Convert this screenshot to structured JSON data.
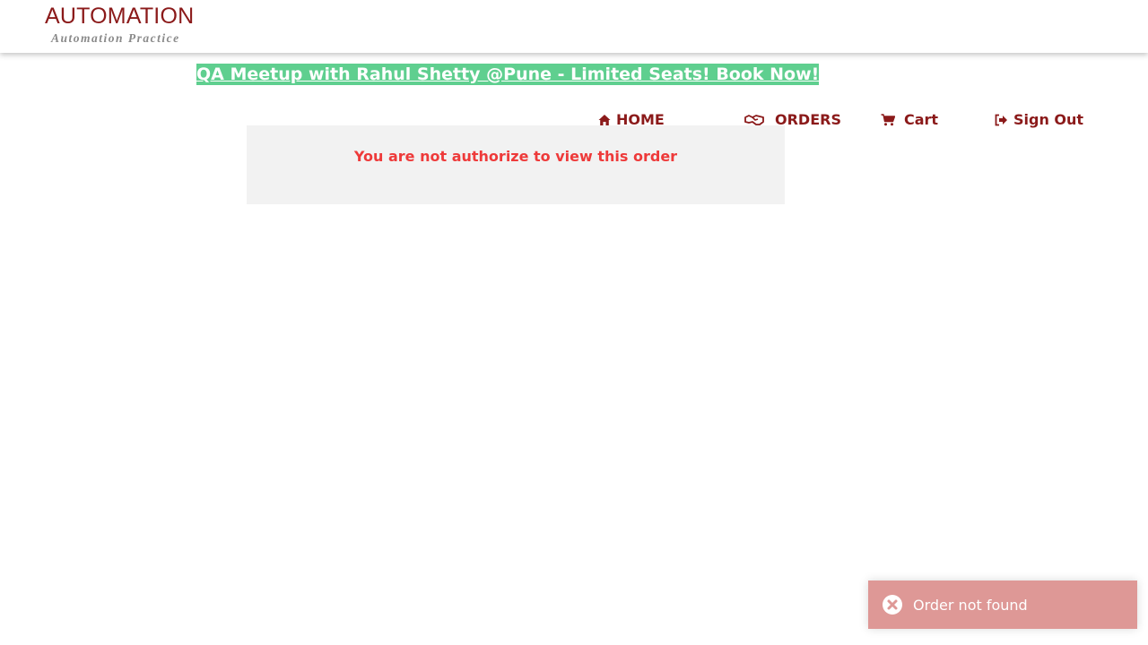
{
  "header": {
    "logo_title": "AUTOMATION",
    "logo_subtitle": "Automation Practice"
  },
  "banner": {
    "text": "QA Meetup with Rahul Shetty @Pune - Limited Seats! Book Now!"
  },
  "nav": {
    "items": [
      {
        "label": "HOME",
        "icon": "home-icon"
      },
      {
        "label": "ORDERS",
        "icon": "handshake-icon"
      },
      {
        "label": "Cart",
        "icon": "cart-icon"
      },
      {
        "label": "Sign Out",
        "icon": "sign-out-icon"
      }
    ]
  },
  "main": {
    "message": "You are not authorize to view this order"
  },
  "toast": {
    "message": "Order not found",
    "icon": "close-circle-icon"
  },
  "colors": {
    "brand": "#8b1a1a",
    "banner_bg": "#5fcf8f",
    "error_text": "#ee3a3a",
    "toast_bg": "#de9896"
  }
}
